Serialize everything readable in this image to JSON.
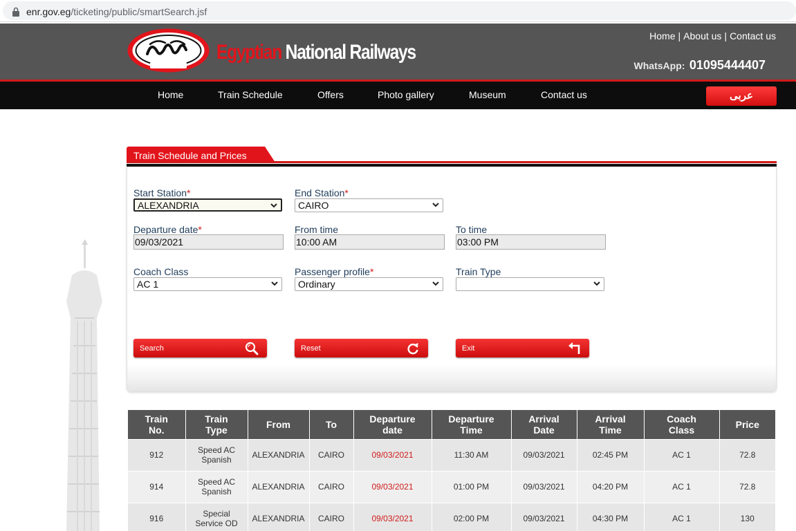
{
  "browser": {
    "url_host": "enr.gov.eg",
    "url_path": "/ticketing/public/smartSearch.jsf"
  },
  "header": {
    "logo_word_red": "Egyptian",
    "logo_word_white": "National Railways",
    "top_links": [
      "Home",
      "About us",
      "Contact us"
    ],
    "whatsapp_label": "WhatsApp:",
    "whatsapp_number": "01095444407"
  },
  "nav": {
    "items": [
      "Home",
      "Train Schedule",
      "Offers",
      "Photo gallery",
      "Museum",
      "Contact us"
    ],
    "language_button": "عربى"
  },
  "form": {
    "tab_title": "Train Schedule and Prices",
    "start_station": {
      "label": "Start Station",
      "value": "ALEXANDRIA"
    },
    "end_station": {
      "label": "End Station",
      "value": "CAIRO"
    },
    "departure_date": {
      "label": "Departure date",
      "value": "09/03/2021"
    },
    "from_time": {
      "label": "From time",
      "value": "10:00 AM"
    },
    "to_time": {
      "label": "To time",
      "value": "03:00 PM"
    },
    "coach_class": {
      "label": "Coach Class",
      "value": "AC 1"
    },
    "passenger_profile": {
      "label": "Passenger profile",
      "value": "Ordinary"
    },
    "train_type": {
      "label": "Train Type",
      "value": ""
    },
    "required_marker": "*",
    "buttons": {
      "search": "Search",
      "reset": "Reset",
      "exit": "Exit"
    }
  },
  "table": {
    "headers": [
      [
        "Train",
        "No."
      ],
      [
        "Train",
        "Type"
      ],
      [
        "From"
      ],
      [
        "To"
      ],
      [
        "Departure",
        "date"
      ],
      [
        "Departure",
        "Time"
      ],
      [
        "Arrival",
        "Date"
      ],
      [
        "Arrival",
        "Time"
      ],
      [
        "Coach",
        "Class"
      ],
      [
        "Price"
      ]
    ],
    "rows": [
      {
        "train_no": "912",
        "type_l1": "Speed AC",
        "type_l2": "Spanish",
        "from": "ALEXANDRIA",
        "to": "CAIRO",
        "dep_date": "09/03/2021",
        "dep_time": "11:30 AM",
        "arr_date": "09/03/2021",
        "arr_time": "02:45 PM",
        "coach": "AC 1",
        "price": "72.8"
      },
      {
        "train_no": "914",
        "type_l1": "Speed AC",
        "type_l2": "Spanish",
        "from": "ALEXANDRIA",
        "to": "CAIRO",
        "dep_date": "09/03/2021",
        "dep_time": "01:00 PM",
        "arr_date": "09/03/2021",
        "arr_time": "04:20 PM",
        "coach": "AC 1",
        "price": "72.8"
      },
      {
        "train_no": "916",
        "type_l1": "Special",
        "type_l2": "Service OD",
        "from": "ALEXANDRIA",
        "to": "CAIRO",
        "dep_date": "09/03/2021",
        "dep_time": "02:00 PM",
        "arr_date": "09/03/2021",
        "arr_time": "04:30 PM",
        "coach": "AC 1",
        "price": "130"
      }
    ]
  },
  "colors": {
    "brand_red": "#e2141b",
    "header_gray": "#555555",
    "nav_black": "#0d0d0d",
    "date_red": "#d11a1a"
  }
}
